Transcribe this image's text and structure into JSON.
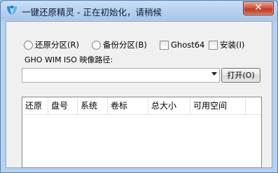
{
  "window": {
    "title": "一键还原精灵 - 正在初始化，请稍候",
    "close_label": "✕",
    "app_icon": "app-logo-icon"
  },
  "options": {
    "restore_partition": "还原分区(R)",
    "backup_partition": "备份分区(B)",
    "ghost64": "Ghost64",
    "install": "安装(I)"
  },
  "path": {
    "label": "GHO WIM ISO 映像路径:",
    "value": "",
    "open_button": "打开(O)"
  },
  "table": {
    "columns": [
      "还原",
      "盘号",
      "系统",
      "卷标",
      "总大小",
      "可用空间"
    ],
    "rows": []
  }
}
